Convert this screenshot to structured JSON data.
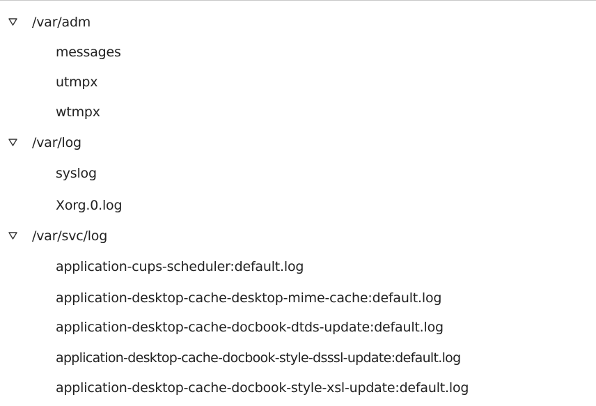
{
  "tree": {
    "folders": [
      {
        "label": "/var/adm",
        "expanded": true,
        "files": [
          "messages",
          "utmpx",
          "wtmpx"
        ]
      },
      {
        "label": "/var/log",
        "expanded": true,
        "files": [
          "syslog",
          "Xorg.0.log"
        ]
      },
      {
        "label": "/var/svc/log",
        "expanded": true,
        "files": [
          "application-cups-scheduler:default.log",
          "application-desktop-cache-desktop-mime-cache:default.log",
          "application-desktop-cache-docbook-dtds-update:default.log",
          "application-desktop-cache-docbook-style-dsssl-update:default.log",
          "application-desktop-cache-docbook-style-xsl-update:default.log"
        ]
      }
    ]
  },
  "icons": {
    "expander": "triangle-down-outline-icon"
  },
  "colors": {
    "text": "#222222",
    "background": "#ffffff",
    "expander": "#333333"
  }
}
